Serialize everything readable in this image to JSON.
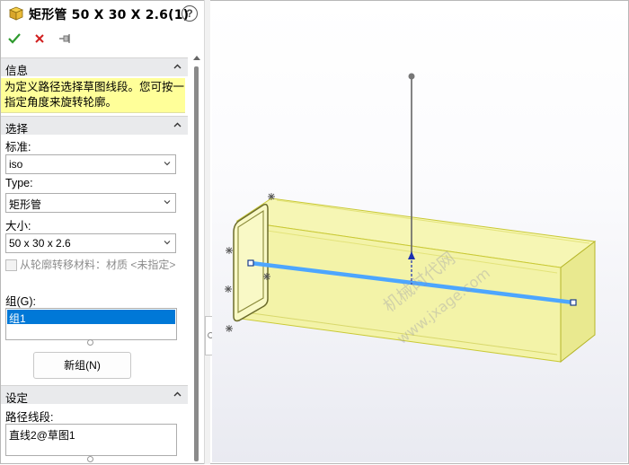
{
  "header": {
    "title": "矩形管 50 X 30 X 2.6(1)",
    "help_symbol": "?"
  },
  "toolbar": {
    "ok_icon": "check-icon",
    "cancel_icon": "x-icon",
    "pin_icon": "pushpin-icon"
  },
  "sections": {
    "info": {
      "title": "信息",
      "message": "为定义路径选择草图线段。您可按一指定角度来旋转轮廓。"
    },
    "selection": {
      "title": "选择",
      "standard_label": "标准:",
      "standard_value": "iso",
      "type_label": "Type:",
      "type_value": "矩形管",
      "size_label": "大小:",
      "size_value": "50 x 30 x 2.6",
      "transfer_checkbox_label": "从轮廓转移材料：材质 <未指定>",
      "group_label": "组(G):",
      "groups": [
        "组1"
      ],
      "new_group_button": "新组(N)"
    },
    "settings": {
      "title": "设定",
      "path_segments_label": "路径线段:",
      "path_segments_value": "直线2@草图1"
    }
  },
  "viewport": {
    "watermark_line1": "机械时代网",
    "watermark_line2": "www.jxage.com"
  },
  "colors": {
    "accent_selection": "#0078d7",
    "info_background": "#ffff99",
    "ok_green": "#2e9a2e",
    "cancel_red": "#d12020",
    "profile_yellow": "#f3f3a0",
    "path_blue": "#4da6ff"
  }
}
